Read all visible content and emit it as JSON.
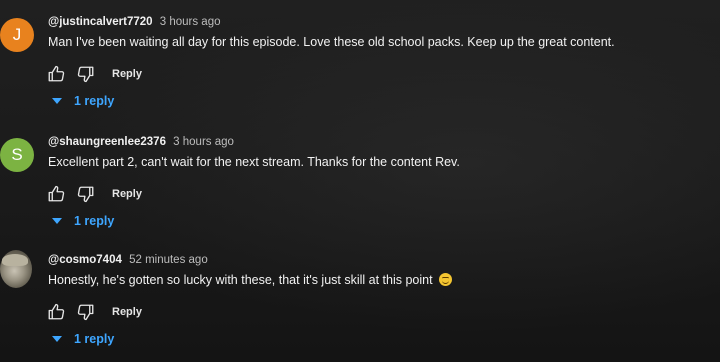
{
  "comments": [
    {
      "avatar_letter": "J",
      "avatar_color": "#e8821e",
      "username": "@justincalvert7720",
      "time": "3 hours ago",
      "text": "Man I've been waiting all day for this episode. Love these old school packs. Keep up the great content.",
      "reply_label": "Reply",
      "replies_label": "1 reply"
    },
    {
      "avatar_letter": "S",
      "avatar_color": "#7cb342",
      "username": "@shaungreenlee2376",
      "time": "3 hours ago",
      "text": "Excellent part 2, can't wait for the next stream. Thanks for the content Rev.",
      "reply_label": "Reply",
      "replies_label": "1 reply"
    },
    {
      "avatar_letter": "",
      "avatar_color": "#9a9484",
      "username": "@cosmo7404",
      "time": "52 minutes ago",
      "text": "Honestly, he's gotten so lucky with these, that it's just skill at this point",
      "emoji": "grimacing-face-emoji",
      "reply_label": "Reply",
      "replies_label": "1 reply"
    }
  ],
  "icons": {
    "like": "thumbs-up-icon",
    "dislike": "thumbs-down-icon",
    "expand": "chevron-down-icon"
  },
  "colors": {
    "accent_link": "#3ea6ff",
    "background": "#1c1c1c"
  }
}
